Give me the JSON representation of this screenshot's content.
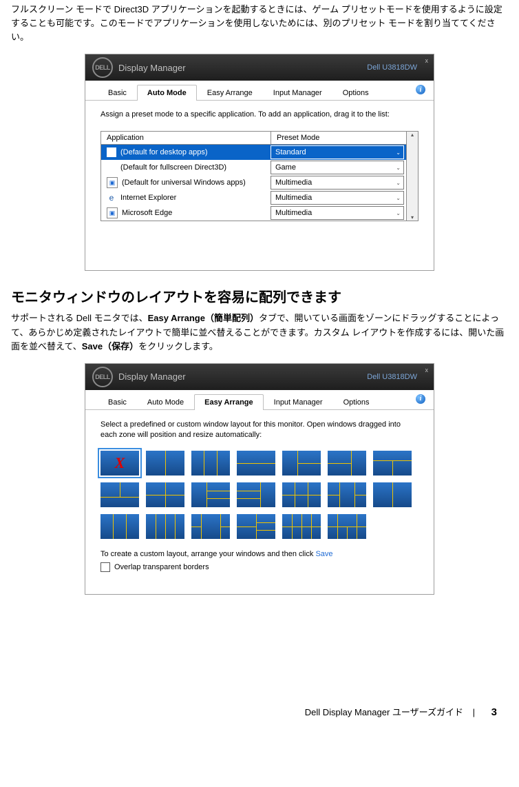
{
  "doc": {
    "p1": "フルスクリーン モードで Direct3D アプリケーションを起動するときには、ゲーム プリセットモードを使用するように設定することも可能です。このモードでアプリケーションを使用しないためには、別のプリセット モードを割り当ててください。",
    "heading": "モニタウィンドウのレイアウトを容易に配列できます",
    "p2a": "サポートされる Dell モニタでは、",
    "p2b": "Easy Arrange（簡単配列）",
    "p2c": "タブで、開いている画面をゾーンにドラッグすることによって、あらかじめ定義されたレイアウトで簡単に並べ替えることができます。カスタム レイアウトを作成するには、開いた画面を並べ替えて、",
    "p2d": "Save（保存）",
    "p2e": "をクリックします。"
  },
  "dialog": {
    "title": "Display Manager",
    "model": "Dell U3818DW",
    "close": "x",
    "info": "i",
    "tabs": {
      "basic": "Basic",
      "auto": "Auto Mode",
      "easy": "Easy Arrange",
      "input": "Input Manager",
      "options": "Options"
    }
  },
  "automode": {
    "intro": "Assign a preset mode to a specific application.  To add an application, drag it to the list:",
    "head_app": "Application",
    "head_mode": "Preset Mode",
    "rows": [
      {
        "app": "(Default for desktop apps)",
        "mode": "Standard",
        "icon": "blank",
        "selected": true
      },
      {
        "app": "(Default for fullscreen Direct3D)",
        "mode": "Game",
        "icon": "blank",
        "selected": false
      },
      {
        "app": "(Default for universal Windows apps)",
        "mode": "Multimedia",
        "icon": "win",
        "selected": false
      },
      {
        "app": "Internet Explorer",
        "mode": "Multimedia",
        "icon": "ie",
        "selected": false
      },
      {
        "app": "Microsoft Edge",
        "mode": "Multimedia",
        "icon": "win",
        "selected": false
      }
    ],
    "scroll_up": "▴",
    "scroll_down": "▾"
  },
  "easyarrange": {
    "intro": "Select a predefined or custom window layout for this monitor.  Open windows dragged into each zone will position and resize automatically:",
    "foot_pre": "To create a custom layout, arrange your windows and then click",
    "foot_link": "Save",
    "overlap": "Overlap transparent borders"
  },
  "footer": {
    "text": "Dell Display Manager ユーザーズガイド",
    "sep": "|",
    "page": "3"
  }
}
